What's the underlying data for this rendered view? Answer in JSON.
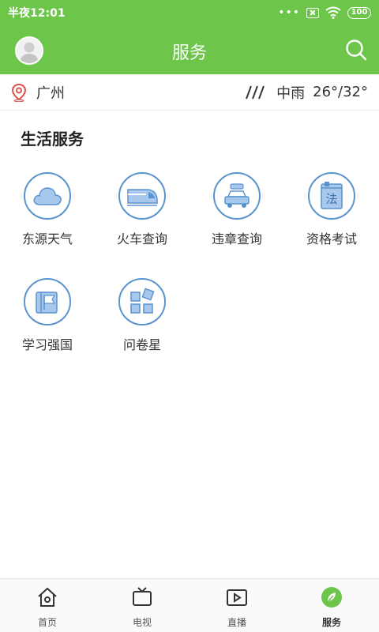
{
  "status_bar": {
    "time": "半夜12:01",
    "dots": "•••",
    "battery": "100"
  },
  "header": {
    "title": "服务"
  },
  "location": {
    "city": "广州",
    "weather": "中雨",
    "temperature": "26°/32°"
  },
  "section": {
    "title": "生活服务"
  },
  "services": [
    {
      "label": "东源天气",
      "icon": "cloud-icon"
    },
    {
      "label": "火车查询",
      "icon": "train-icon"
    },
    {
      "label": "违章查询",
      "icon": "car-icon"
    },
    {
      "label": "资格考试",
      "icon": "law-book-icon"
    },
    {
      "label": "学习强国",
      "icon": "flag-book-icon"
    },
    {
      "label": "问卷星",
      "icon": "grid-blocks-icon"
    }
  ],
  "bottom_nav": [
    {
      "label": "首页",
      "icon": "home-icon"
    },
    {
      "label": "电视",
      "icon": "tv-icon"
    },
    {
      "label": "直播",
      "icon": "live-video-icon"
    },
    {
      "label": "服务",
      "icon": "leaf-service-icon",
      "active": true
    }
  ],
  "colors": {
    "primary_green": "#6dc54a",
    "icon_blue": "#5b93cf",
    "active_green": "#6dc54a"
  }
}
